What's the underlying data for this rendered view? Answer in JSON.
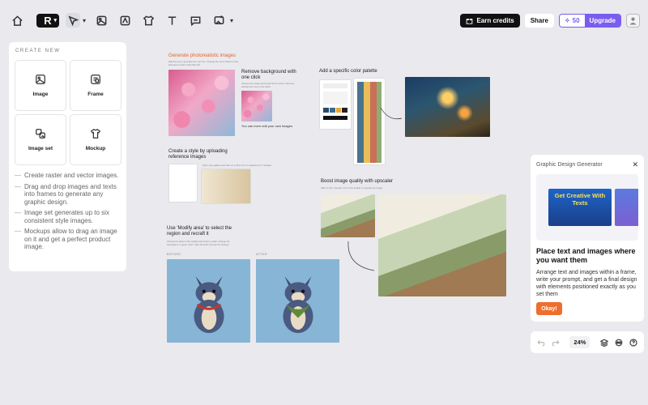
{
  "toolbar": {
    "logo_letter": "R",
    "earn_credits": "Earn credits",
    "share": "Share",
    "credits_count": "50",
    "upgrade": "Upgrade"
  },
  "create_new": {
    "heading": "CREATE NEW",
    "tiles": [
      {
        "label": "Image",
        "icon": "image-icon"
      },
      {
        "label": "Frame",
        "icon": "frame-icon"
      },
      {
        "label": "Image set",
        "icon": "image-set-icon"
      },
      {
        "label": "Mockup",
        "icon": "tshirt-icon"
      }
    ],
    "tips": [
      "Create raster and vector images.",
      "Drag and drop images and texts into frames to generate any graphic design.",
      "Image set generates up to six consistent style images.",
      "Mockups allow to drag an image on it and get a perfect product image."
    ]
  },
  "canvas": {
    "generate_title": "Generate photorealistic images",
    "generate_desc": "Edit the text to generate the new one. Change the word 'nature' to the left panel to start. Click 'Recraft'.",
    "remove_bg_title": "Remove background with one click",
    "remove_bg_desc": "Choose the image below and find a custom 'Remove background' tool in the editor.",
    "edit_own": "You can even edit your own images",
    "color_title": "Add a specific color palette",
    "style_title": "Create a style by uploading reference images",
    "style_desc": "Open style gallery and click on a 'Plus' icon to upload up to 5 images.",
    "upscale_title": "Boost image quality with upscaler",
    "upscale_desc": "Click on the 'Upscale' icon in the toolbar to upscale the image.",
    "modify_title": "Use 'Modify area' to select the region and recraft it",
    "modify_desc": "Choose the lasso in the toolbar and select a collar. Change the description to 'green scarf'. Click 'Recraft' and see the change.",
    "before": "BEFORE",
    "after": "AFTER"
  },
  "gdg": {
    "title": "Graphic Design Generator",
    "thumb_text": "Get Creative With Texts",
    "heading": "Place text and images where you want them",
    "body": "Arrange text and images within a frame, write your prompt, and get a final design with elements positioned exactly as you set them",
    "okay": "Okay!"
  },
  "zoom": {
    "level": "24%"
  },
  "colors": {
    "accent": "#7b5cf0",
    "orange": "#ee6f2d",
    "canvas_bg": "#e9e9ee"
  }
}
